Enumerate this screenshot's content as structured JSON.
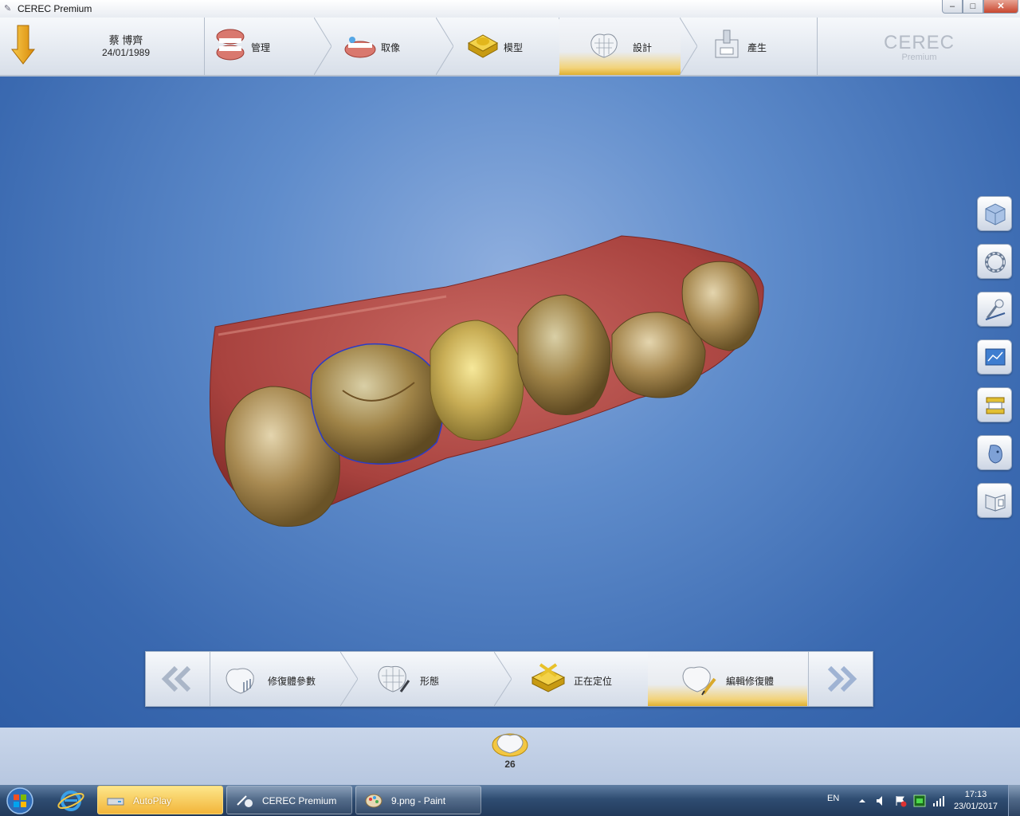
{
  "window": {
    "title": "CEREC Premium",
    "min": "–",
    "max": "□",
    "close": "✕"
  },
  "patient": {
    "name": "蔡 博齊",
    "dob": "24/01/1989"
  },
  "workflow": {
    "steps": [
      {
        "label": "管理",
        "icon": "jaw-icon"
      },
      {
        "label": "取像",
        "icon": "scan-icon"
      },
      {
        "label": "模型",
        "icon": "model-icon"
      },
      {
        "label": "設計",
        "icon": "design-icon",
        "active": true
      },
      {
        "label": "產生",
        "icon": "milling-icon"
      }
    ]
  },
  "brand": {
    "name": "CEREC",
    "edition": "Premium"
  },
  "side_tools": [
    {
      "name": "view-cube-icon"
    },
    {
      "name": "rotate-ring-icon"
    },
    {
      "name": "tool-instrument-icon"
    },
    {
      "name": "analysis-screen-icon"
    },
    {
      "name": "articulator-icon"
    },
    {
      "name": "face-icon"
    },
    {
      "name": "documents-icon"
    }
  ],
  "design_steps": {
    "prev": "«",
    "next": "»",
    "items": [
      {
        "label": "修復體參數"
      },
      {
        "label": "形態"
      },
      {
        "label": "正在定位"
      },
      {
        "label": "編輯修復體",
        "active": true
      }
    ]
  },
  "restoration": {
    "tooth_number": "26"
  },
  "taskbar": {
    "items": [
      {
        "label": "AutoPlay",
        "active": true
      },
      {
        "label": "CEREC Premium"
      },
      {
        "label": "9.png - Paint"
      }
    ],
    "lang": "EN",
    "time": "17:13",
    "date": "23/01/2017"
  },
  "colors": {
    "accent": "#e6b531",
    "viewport": "#3d6db2",
    "taskbar": "#2f4d72"
  }
}
